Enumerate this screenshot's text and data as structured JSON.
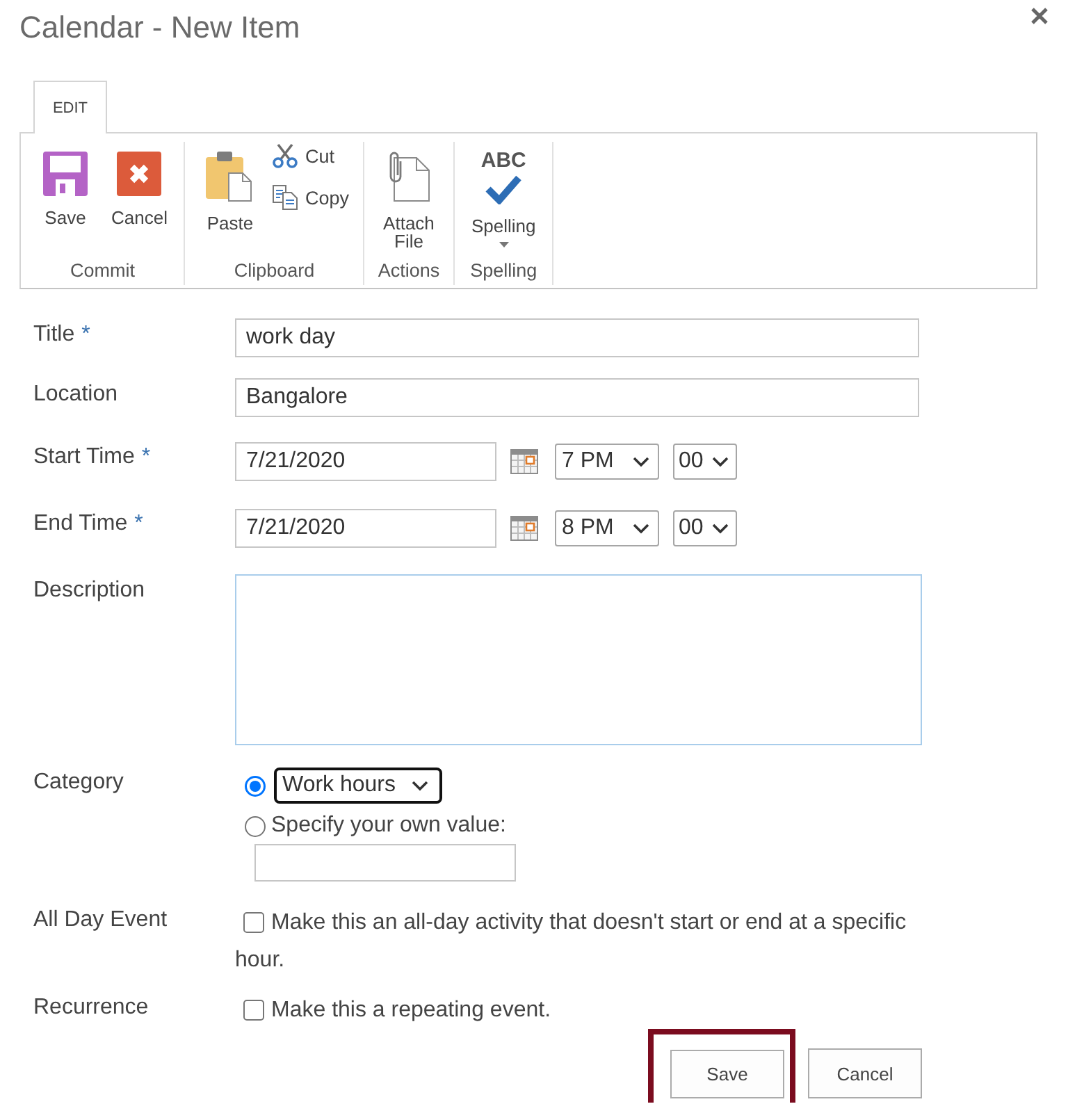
{
  "window": {
    "title": "Calendar - New Item"
  },
  "ribbon": {
    "tabs": [
      {
        "label": "EDIT",
        "selected": true
      }
    ],
    "groups": [
      {
        "label": "Commit",
        "commands": [
          {
            "kind": "save",
            "label": "Save"
          },
          {
            "kind": "cancel",
            "label": "Cancel"
          }
        ]
      },
      {
        "label": "Clipboard",
        "commands": [
          {
            "kind": "paste",
            "label": "Paste"
          },
          {
            "kind": "cut",
            "label": "Cut"
          },
          {
            "kind": "copy",
            "label": "Copy"
          }
        ]
      },
      {
        "label": "Actions",
        "commands": [
          {
            "kind": "attach",
            "label": "Attach File"
          }
        ]
      },
      {
        "label": "Spelling",
        "commands": [
          {
            "kind": "spelling",
            "label": "Spelling",
            "icon_text": "ABC",
            "dropdown": true
          }
        ]
      }
    ]
  },
  "form": {
    "fields": [
      {
        "kind": "text",
        "label": "Title",
        "required_mark": "*",
        "value": "work day",
        "focused": false
      },
      {
        "kind": "text",
        "label": "Location",
        "value": "Bangalore",
        "focused": false
      },
      {
        "kind": "datetime",
        "label": "Start Time",
        "required_mark": "*",
        "date": "7/21/2020",
        "hour": "7 PM",
        "minute": "00"
      },
      {
        "kind": "datetime",
        "label": "End Time",
        "required_mark": "*",
        "date": "7/21/2020",
        "hour": "8 PM",
        "minute": "00"
      },
      {
        "kind": "multiline",
        "label": "Description",
        "focused": true
      },
      {
        "kind": "choice",
        "label": "Category",
        "options": [
          {
            "kind": "dropdown",
            "value": "Work hours",
            "selected": true,
            "focused": true
          },
          {
            "kind": "custom",
            "label": "Specify your own value:",
            "selected": false
          }
        ]
      },
      {
        "kind": "checkbox",
        "label": "All Day Event",
        "text": "Make this an all-day activity that doesn't start or end at a specific hour.",
        "checked": false
      },
      {
        "kind": "checkbox",
        "label": "Recurrence",
        "text": "Make this a repeating event.",
        "checked": false
      }
    ]
  },
  "buttons": [
    {
      "label": "Save",
      "highlighted": true
    },
    {
      "label": "Cancel",
      "highlighted": false
    }
  ]
}
